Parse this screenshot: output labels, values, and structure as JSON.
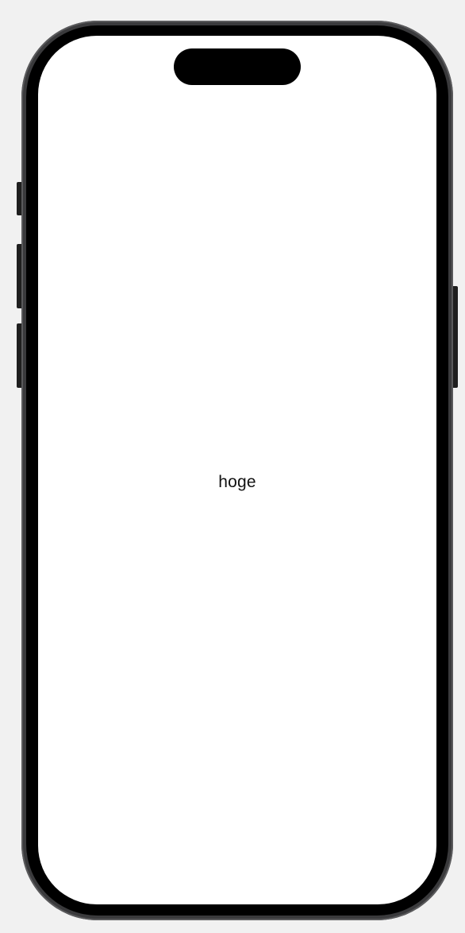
{
  "screen": {
    "label": "hoge"
  },
  "device": {
    "frame_color": "#3a3a3c",
    "bezel_color": "#000000",
    "screen_color": "#ffffff",
    "background_color": "#f1f1f1"
  }
}
